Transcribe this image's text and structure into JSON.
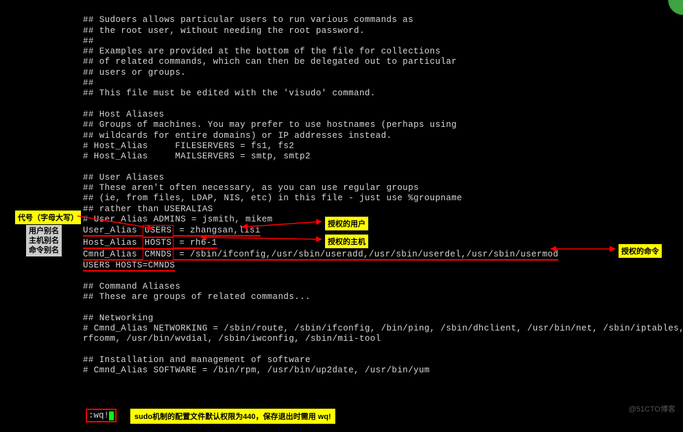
{
  "file_lines": [
    "## Sudoers allows particular users to run various commands as",
    "## the root user, without needing the root password.",
    "##",
    "## Examples are provided at the bottom of the file for collections",
    "## of related commands, which can then be delegated out to particular",
    "## users or groups.",
    "##",
    "## This file must be edited with the 'visudo' command.",
    "",
    "## Host Aliases",
    "## Groups of machines. You may prefer to use hostnames (perhaps using",
    "## wildcards for entire domains) or IP addresses instead.",
    "# Host_Alias     FILESERVERS = fs1, fs2",
    "# Host_Alias     MAILSERVERS = smtp, smtp2",
    "",
    "## User Aliases",
    "## These aren't often necessary, as you can use regular groups",
    "## (ie, from files, LDAP, NIS, etc) in this file - just use %groupname",
    "## rather than USERALIAS",
    "# User_Alias ADMINS = jsmith, mikem",
    {
      "type": "alias",
      "key": "User_Alias",
      "code": "USERS",
      "eq": " = ",
      "val": "zhangsan,lisi"
    },
    {
      "type": "alias",
      "key": "Host_Alias",
      "code": "HOSTS",
      "eq": " = ",
      "val": "rh6-1"
    },
    {
      "type": "alias",
      "key": "Cmnd_Alias",
      "code": "CMNDS",
      "eq": " = ",
      "val": "/sbin/ifconfig,/usr/sbin/useradd,/usr/sbin/userdel,/usr/sbin/usermod"
    },
    {
      "type": "rule",
      "text": "USERS HOSTS=CMNDS"
    },
    "",
    "## Command Aliases",
    "## These are groups of related commands...",
    "",
    "## Networking",
    "# Cmnd_Alias NETWORKING = /sbin/route, /sbin/ifconfig, /bin/ping, /sbin/dhclient, /usr/bin/net, /sbin/iptables,",
    "rfcomm, /usr/bin/wvdial, /sbin/iwconfig, /sbin/mii-tool",
    "",
    "## Installation and management of software",
    "# Cmnd_Alias SOFTWARE = /bin/rpm, /usr/bin/up2date, /usr/bin/yum"
  ],
  "labels": {
    "dai_hao": "代号（字母大写）",
    "alias_types": "用户别名\n主机别名\n命令别名",
    "auth_user": "授权的用户",
    "auth_host": "授权的主机",
    "auth_cmd": "授权的命令"
  },
  "wq": ":wq!",
  "wq_note": "sudo机制的配置文件默认权限为440，保存退出时需用 wq!",
  "watermark": "@51CTO博客"
}
